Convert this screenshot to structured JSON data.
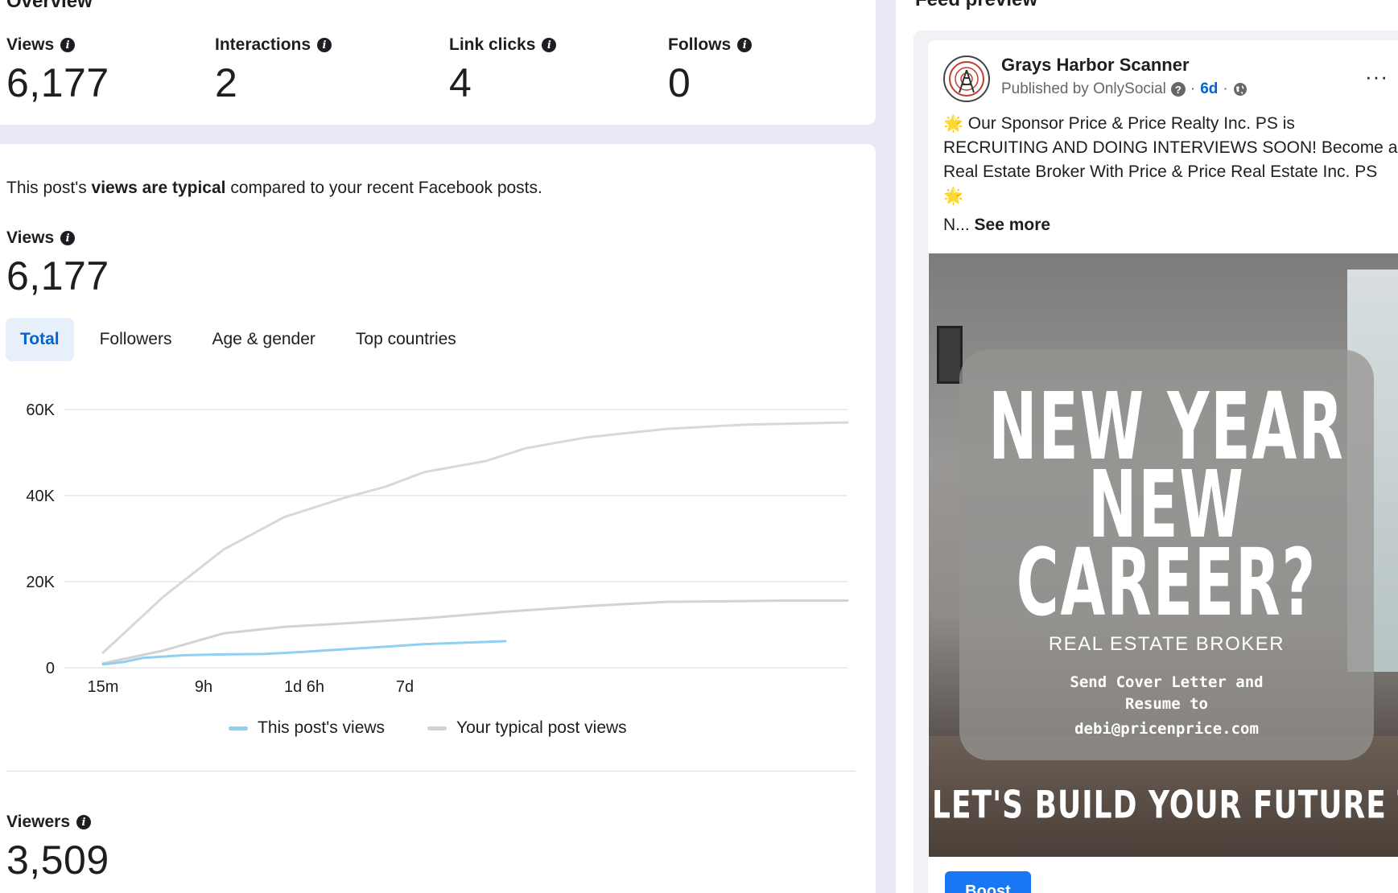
{
  "overview": {
    "heading": "Overview",
    "metrics": [
      {
        "label": "Views",
        "value": "6,177"
      },
      {
        "label": "Interactions",
        "value": "2"
      },
      {
        "label": "Link clicks",
        "value": "4"
      },
      {
        "label": "Follows",
        "value": "0"
      }
    ]
  },
  "detail": {
    "summary_prefix": "This post's ",
    "summary_bold": "views are typical",
    "summary_suffix": " compared to your recent Facebook posts.",
    "views_label": "Views",
    "views_value": "6,177",
    "tabs": [
      "Total",
      "Followers",
      "Age & gender",
      "Top countries"
    ],
    "active_tab": "Total",
    "viewers_label": "Viewers",
    "viewers_value": "3,509"
  },
  "chart_data": {
    "type": "line",
    "y_ticks": [
      "60K",
      "40K",
      "20K",
      "0"
    ],
    "x_ticks": [
      "15m",
      "9h",
      "1d 6h",
      "7d"
    ],
    "ylim": [
      0,
      60000
    ],
    "series": [
      {
        "name": "This post's views",
        "color": "#8fd0f2",
        "values": [
          [
            0,
            800
          ],
          [
            0.5,
            1300
          ],
          [
            1,
            2300
          ],
          [
            2,
            2900
          ],
          [
            3,
            3100
          ],
          [
            4,
            3200
          ],
          [
            5,
            3700
          ],
          [
            6,
            4300
          ],
          [
            6.7,
            4700
          ],
          [
            8,
            5500
          ],
          [
            10,
            6177
          ]
        ]
      },
      {
        "name": "Your typical post views",
        "color": "#d2d2d2",
        "values": [
          [
            0,
            1000
          ],
          [
            1.5,
            4000
          ],
          [
            3,
            8000
          ],
          [
            4.5,
            9500
          ],
          [
            6,
            10300
          ],
          [
            8,
            11500
          ],
          [
            10,
            13000
          ],
          [
            12,
            14300
          ],
          [
            14,
            15300
          ],
          [
            16,
            15500
          ],
          [
            17,
            15600
          ],
          [
            18.5,
            15600
          ]
        ]
      },
      {
        "name": "",
        "color": "#d8d8d8",
        "values": [
          [
            0,
            3500
          ],
          [
            1.5,
            16500
          ],
          [
            3,
            27500
          ],
          [
            4.5,
            35000
          ],
          [
            6,
            39500
          ],
          [
            7,
            42000
          ],
          [
            8,
            45500
          ],
          [
            9.5,
            48000
          ],
          [
            10.5,
            51000
          ],
          [
            12,
            53500
          ],
          [
            14,
            55500
          ],
          [
            16,
            56500
          ],
          [
            18.5,
            57000
          ]
        ]
      }
    ]
  },
  "feed": {
    "heading": "Feed preview",
    "page_name": "Grays Harbor Scanner",
    "published_by": "Published by OnlySocial",
    "help_glyph": "?",
    "time": "6d",
    "separator": "·",
    "more_glyph": "···",
    "text_sun": "🌟",
    "text_body": "Our Sponsor Price & Price Realty Inc. PS is RECRUITING AND DOING INTERVIEWS SOON! Become a Real Estate Broker With Price & Price Real Estate Inc. PS",
    "text_tail": "N...",
    "see_more": "See more",
    "image": {
      "line1": "NEW YEAR",
      "line2": "NEW",
      "line3": "CAREER?",
      "subtitle": "REAL ESTATE BROKER",
      "contact1": "Send Cover Letter and",
      "contact2": "Resume to",
      "email": "debi@pricenprice.com",
      "banner": "LET'S BUILD YOUR FUTURE TOGETHE"
    },
    "boost_label": "Boost"
  }
}
